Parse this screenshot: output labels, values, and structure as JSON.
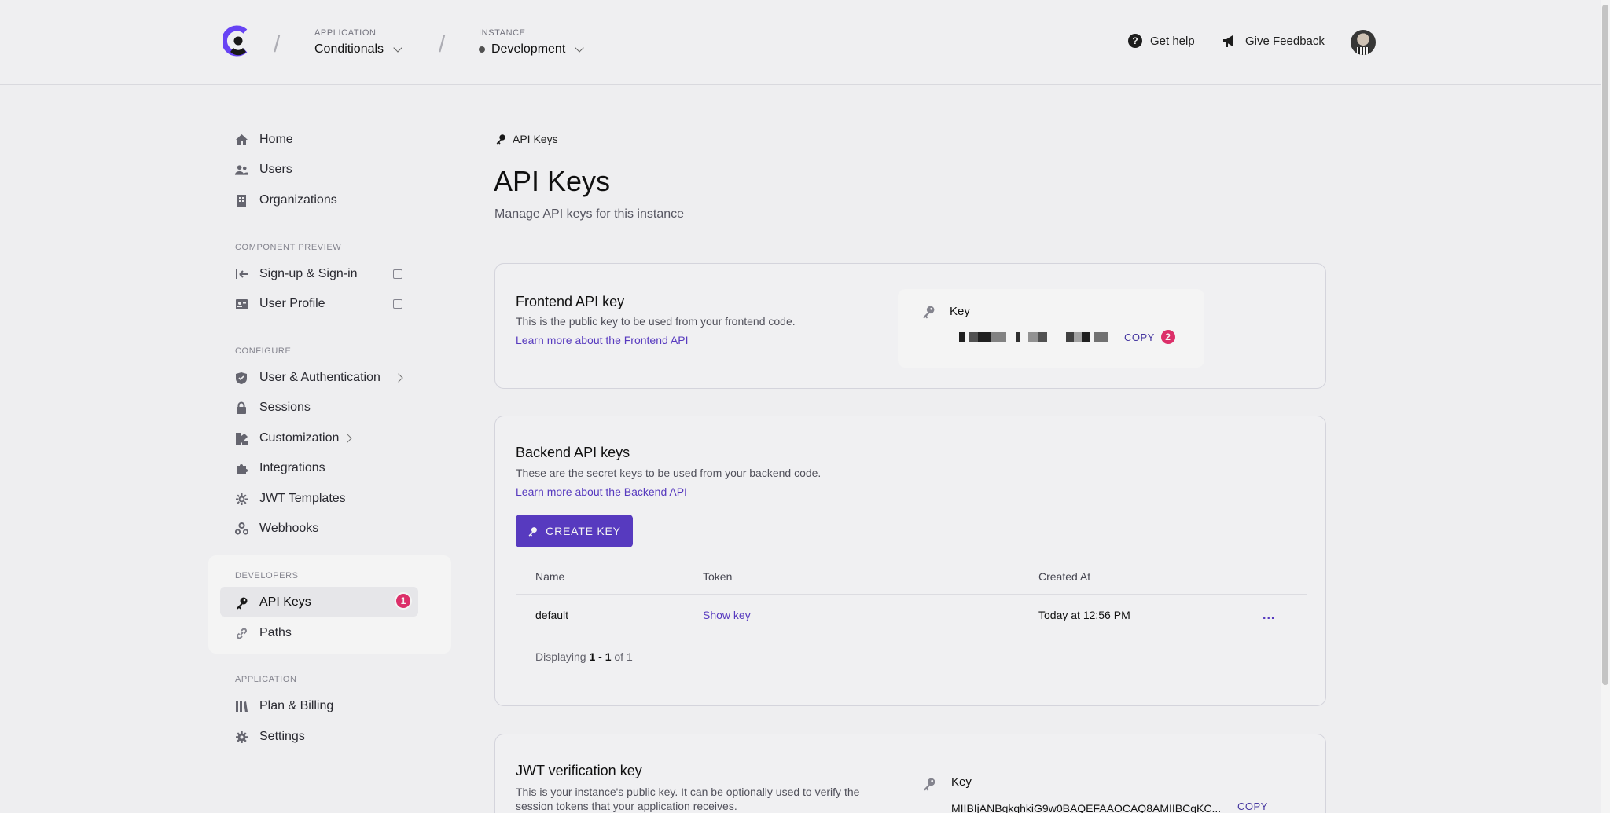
{
  "header": {
    "application_label": "APPLICATION",
    "application_value": "Conditionals",
    "instance_label": "INSTANCE",
    "instance_value": "Development",
    "help_label": "Get help",
    "feedback_label": "Give Feedback"
  },
  "sidebar": {
    "main": [
      {
        "label": "Home",
        "icon": "home-icon"
      },
      {
        "label": "Users",
        "icon": "users-icon"
      },
      {
        "label": "Organizations",
        "icon": "building-icon"
      }
    ],
    "component_preview_title": "COMPONENT PREVIEW",
    "component_preview": [
      {
        "label": "Sign-up & Sign-in",
        "icon": "sign-in-icon"
      },
      {
        "label": "User Profile",
        "icon": "profile-card-icon"
      }
    ],
    "configure_title": "CONFIGURE",
    "configure": [
      {
        "label": "User & Authentication",
        "icon": "shield-icon"
      },
      {
        "label": "Sessions",
        "icon": "lock-icon"
      },
      {
        "label": "Customization",
        "icon": "palette-icon"
      },
      {
        "label": "Integrations",
        "icon": "puzzle-icon"
      },
      {
        "label": "JWT Templates",
        "icon": "gear-star-icon"
      },
      {
        "label": "Webhooks",
        "icon": "webhook-icon"
      }
    ],
    "developers_title": "DEVELOPERS",
    "developers": [
      {
        "label": "API Keys",
        "icon": "key-icon",
        "badge": "1"
      },
      {
        "label": "Paths",
        "icon": "link-icon"
      }
    ],
    "application_title": "APPLICATION",
    "application": [
      {
        "label": "Plan & Billing",
        "icon": "billing-icon"
      },
      {
        "label": "Settings",
        "icon": "gear-icon"
      }
    ]
  },
  "main": {
    "breadcrumb": "API Keys",
    "title": "API Keys",
    "subtitle": "Manage API keys for this instance",
    "frontend": {
      "title": "Frontend API key",
      "desc": "This is the public key to be used from your frontend code.",
      "link": "Learn more about the Frontend API",
      "key_label": "Key",
      "copy_label": "COPY",
      "copy_badge": "2"
    },
    "backend": {
      "title": "Backend API keys",
      "desc": "These are the secret keys to be used from your backend code.",
      "link": "Learn more about the Backend API",
      "create_label": "CREATE KEY",
      "columns": [
        "Name",
        "Token",
        "Created At"
      ],
      "rows": [
        {
          "name": "default",
          "token": "Show key",
          "created": "Today at 12:56 PM",
          "more": "..."
        }
      ],
      "displaying_prefix": "Displaying",
      "displaying_range": "1 - 1",
      "displaying_of": "of 1"
    },
    "jwt": {
      "title": "JWT verification key",
      "desc_line1": "This is your instance's public key. It can be optionally used to verify the",
      "desc_line2": "session tokens that your application receives.",
      "key_label": "Key",
      "key_value": "MIIBIjANBgkqhkiG9w0BAQEFAAOCAQ8AMIIBCgKC...",
      "copy_label": "COPY"
    }
  },
  "colors": {
    "accent": "#5b3dc8",
    "badge": "#e6326e"
  }
}
